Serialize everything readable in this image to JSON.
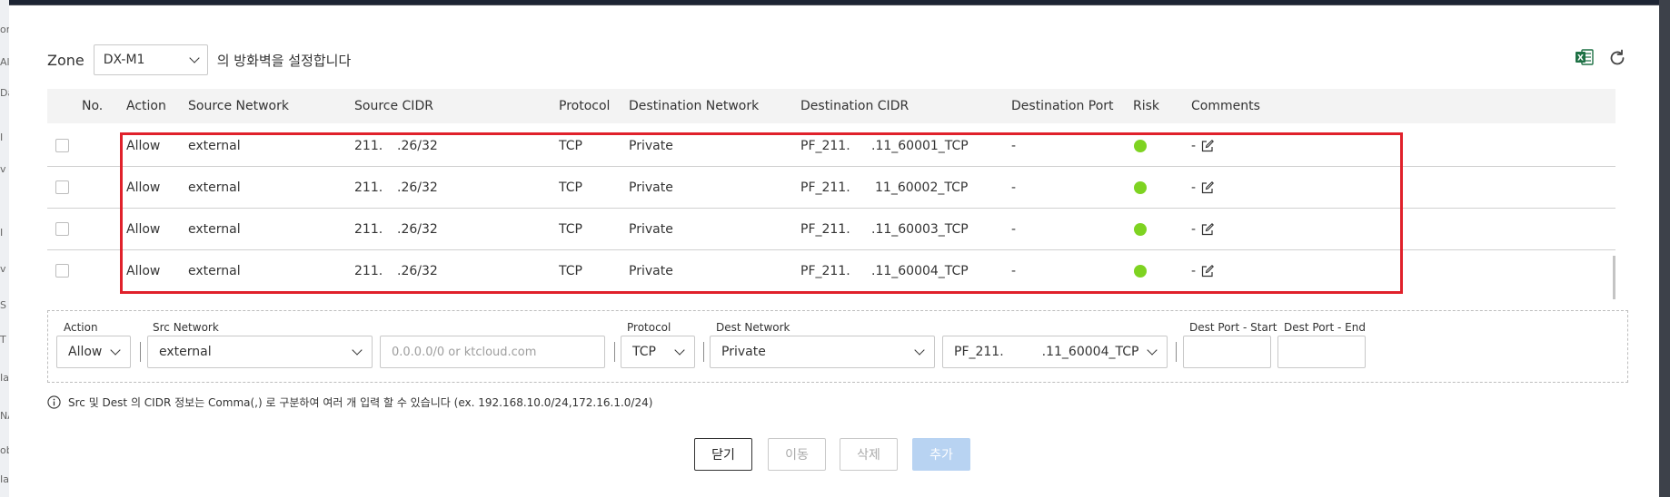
{
  "background": {
    "left_fragments": [
      "or",
      "All",
      "Da",
      "I",
      "v",
      "I",
      "v",
      "S",
      "T",
      "Ia",
      "NA",
      "ob",
      "Ia"
    ]
  },
  "zone": {
    "label": "Zone",
    "selected": "DX-M1",
    "description": "의 방화벽을 설정합니다"
  },
  "toolbar": {
    "excel_icon": "excel-icon",
    "refresh_icon": "refresh-icon"
  },
  "table": {
    "columns": [
      "No.",
      "Action",
      "Source Network",
      "Source CIDR",
      "Protocol",
      "Destination Network",
      "Destination CIDR",
      "Destination Port",
      "Risk",
      "Comments"
    ],
    "rows": [
      {
        "action": "Allow",
        "source_network": "external",
        "source_cidr_a": "211.",
        "source_cidr_b": ".26/32",
        "protocol": "TCP",
        "destination_network": "Private",
        "destination_cidr_a": "PF_211.",
        "destination_cidr_b": ".11_60001_TCP",
        "destination_port": "-",
        "risk_color": "#7ed321",
        "comment": "-"
      },
      {
        "action": "Allow",
        "source_network": "external",
        "source_cidr_a": "211.",
        "source_cidr_b": ".26/32",
        "protocol": "TCP",
        "destination_network": "Private",
        "destination_cidr_a": "PF_211.",
        "destination_cidr_b": "11_60002_TCP",
        "destination_port": "-",
        "risk_color": "#7ed321",
        "comment": "-"
      },
      {
        "action": "Allow",
        "source_network": "external",
        "source_cidr_a": "211.",
        "source_cidr_b": ".26/32",
        "protocol": "TCP",
        "destination_network": "Private",
        "destination_cidr_a": "PF_211.",
        "destination_cidr_b": ".11_60003_TCP",
        "destination_port": "-",
        "risk_color": "#7ed321",
        "comment": "-"
      },
      {
        "action": "Allow",
        "source_network": "external",
        "source_cidr_a": "211.",
        "source_cidr_b": ".26/32",
        "protocol": "TCP",
        "destination_network": "Private",
        "destination_cidr_a": "PF_211.",
        "destination_cidr_b": ".11_60004_TCP",
        "destination_port": "-",
        "risk_color": "#7ed321",
        "comment": "-"
      }
    ]
  },
  "form": {
    "action_label": "Action",
    "action_value": "Allow",
    "src_network_label": "Src Network",
    "src_network_value": "external",
    "src_cidr_placeholder": "0.0.0.0/0 or ktcloud.com",
    "protocol_label": "Protocol",
    "protocol_value": "TCP",
    "dest_network_label": "Dest Network",
    "dest_network_value": "Private",
    "dest_cidr_value_a": "PF_211.",
    "dest_cidr_value_b": ".11_60004_TCP",
    "dest_port_start_label": "Dest Port - Start",
    "dest_port_end_label": "Dest Port - End"
  },
  "note": "Src 및 Dest 의 CIDR 정보는 Comma(,) 로 구분하여 여러 개 입력 할 수 있습니다 (ex. 192.168.10.0/24,172.16.1.0/24)",
  "buttons": {
    "close": "닫기",
    "move": "이동",
    "delete": "삭제",
    "add": "추가"
  },
  "colors": {
    "highlight": "#e0212b",
    "risk_ok": "#7ed321",
    "excel": "#1e7145",
    "add_button": "#b8d3f2"
  }
}
